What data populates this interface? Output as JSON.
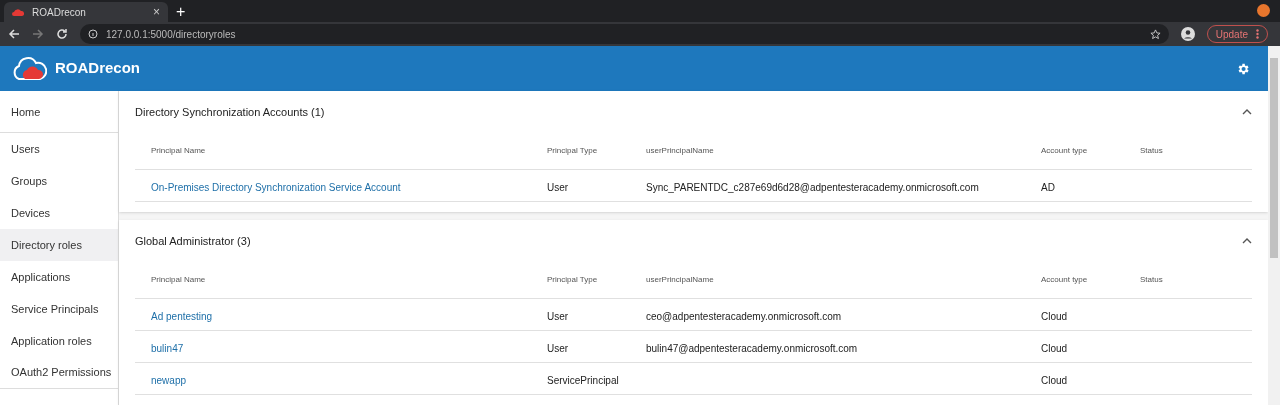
{
  "browser": {
    "tab_title": "ROADrecon",
    "tab_close": "×",
    "new_tab": "+",
    "url": "127.0.0.1:5000/directoryroles",
    "update_button": "Update"
  },
  "app": {
    "title": "ROADrecon"
  },
  "sidebar": {
    "items": [
      {
        "label": "Home",
        "selected": false
      },
      {
        "label": "Users",
        "selected": false
      },
      {
        "label": "Groups",
        "selected": false
      },
      {
        "label": "Devices",
        "selected": false
      },
      {
        "label": "Directory roles",
        "selected": true
      },
      {
        "label": "Applications",
        "selected": false
      },
      {
        "label": "Service Principals",
        "selected": false
      },
      {
        "label": "Application roles",
        "selected": false
      },
      {
        "label": "OAuth2 Permissions",
        "selected": false
      }
    ]
  },
  "sections": [
    {
      "title": "Directory Synchronization Accounts (1)",
      "expanded": true,
      "columns": [
        "Principal Name",
        "Principal Type",
        "userPrincipalName",
        "Account type",
        "Status"
      ],
      "rows": [
        [
          "On-Premises Directory Synchronization Service Account",
          "User",
          "Sync_PARENTDC_c287e69d6d28@adpentesteracademy.onmicrosoft.com",
          "AD",
          ""
        ]
      ]
    },
    {
      "title": "Global Administrator (3)",
      "expanded": true,
      "columns": [
        "Principal Name",
        "Principal Type",
        "userPrincipalName",
        "Account type",
        "Status"
      ],
      "rows": [
        [
          "Ad pentesting",
          "User",
          "ceo@adpentesteracademy.onmicrosoft.com",
          "Cloud",
          ""
        ],
        [
          "bulin47",
          "User",
          "bulin47@adpentesteracademy.onmicrosoft.com",
          "Cloud",
          ""
        ],
        [
          "newapp",
          "ServicePrincipal",
          "",
          "Cloud",
          ""
        ]
      ]
    }
  ]
}
